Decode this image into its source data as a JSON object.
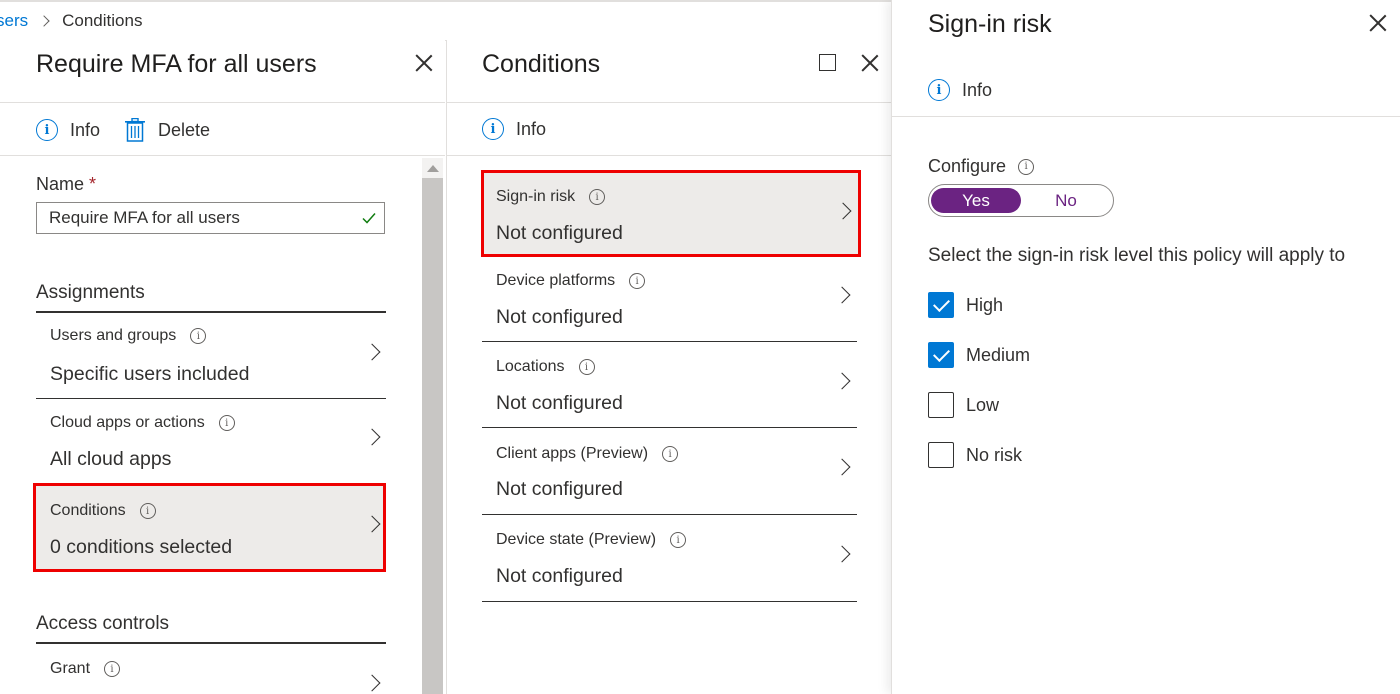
{
  "breadcrumb": {
    "parent": "sers",
    "current": "Conditions"
  },
  "policy_blade": {
    "title": "Require MFA for all users",
    "commands": {
      "info": "Info",
      "delete": "Delete"
    },
    "name_label": "Name",
    "required_marker": "*",
    "name_value": "Require MFA for all users",
    "assignments_heading": "Assignments",
    "items": [
      {
        "title": "Users and groups",
        "value": "Specific users included"
      },
      {
        "title": "Cloud apps or actions",
        "value": "All cloud apps"
      },
      {
        "title": "Conditions",
        "value": "0 conditions selected"
      }
    ],
    "access_controls_heading": "Access controls",
    "grant_label": "Grant"
  },
  "conditions_blade": {
    "title": "Conditions",
    "commands": {
      "info": "Info"
    },
    "items": [
      {
        "title": "Sign-in risk",
        "value": "Not configured"
      },
      {
        "title": "Device platforms",
        "value": "Not configured"
      },
      {
        "title": "Locations",
        "value": "Not configured"
      },
      {
        "title": "Client apps (Preview)",
        "value": "Not configured"
      },
      {
        "title": "Device state (Preview)",
        "value": "Not configured"
      }
    ]
  },
  "signin_risk_blade": {
    "title": "Sign-in risk",
    "commands": {
      "info": "Info"
    },
    "configure_label": "Configure",
    "toggle": {
      "yes": "Yes",
      "no": "No",
      "selected": "Yes"
    },
    "instruction": "Select the sign-in risk level this policy will apply to",
    "levels": [
      {
        "label": "High",
        "checked": true
      },
      {
        "label": "Medium",
        "checked": true
      },
      {
        "label": "Low",
        "checked": false
      },
      {
        "label": "No risk",
        "checked": false
      }
    ]
  },
  "colors": {
    "accent": "#0078d4",
    "toggle_selected": "#6b2382",
    "highlight_border": "#ee0000",
    "valid_check": "#107c10"
  }
}
